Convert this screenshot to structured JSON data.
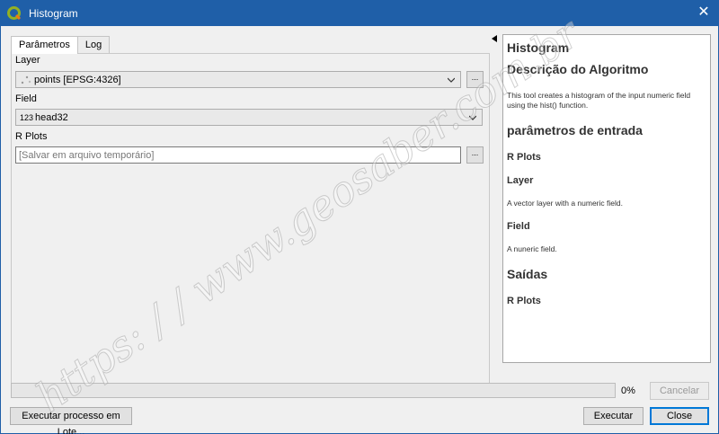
{
  "window": {
    "title": "Histogram",
    "close_symbol": "✕",
    "app_icon": "qgis-logo-icon"
  },
  "tabs": [
    {
      "label": "Parâmetros",
      "active": true
    },
    {
      "label": "Log",
      "active": false
    }
  ],
  "form": {
    "layer_label": "Layer",
    "layer_value": "points [EPSG:4326]",
    "layer_icon": "point-layer-icon",
    "field_label": "Field",
    "field_prefix": "123",
    "field_value": "head32",
    "rplots_label": "R Plots",
    "rplots_placeholder": "[Salvar em arquivo temporário]",
    "browse_label": "..."
  },
  "help": {
    "title": "Histogram",
    "desc_heading": "Descrição do Algoritmo",
    "desc_text": "This tool creates a histogram of the input numeric field using the hist() function.",
    "params_heading": "parâmetros de entrada",
    "param1_name": "R Plots",
    "param2_name": "Layer",
    "param2_desc": "A vector layer with a numeric field.",
    "param3_name": "Field",
    "param3_desc": "A nuneric field.",
    "outputs_heading": "Saídas",
    "output1_name": "R Plots"
  },
  "progress": {
    "value": 0,
    "label": "0%"
  },
  "buttons": {
    "cancel": "Cancelar",
    "batch": "Executar processo em Lote...",
    "run": "Executar",
    "close": "Close"
  },
  "watermark": "https: / / www.geosaber.com.br"
}
